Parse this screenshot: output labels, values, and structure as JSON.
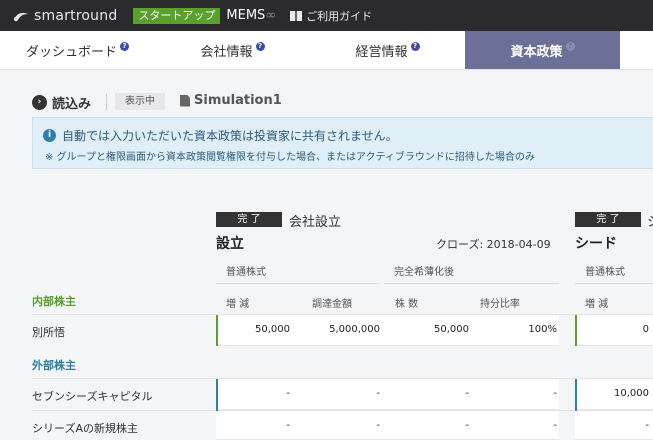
{
  "topbar": {
    "logo": "smartround",
    "plan": "スタートアップ",
    "company": "MEMS",
    "company_suffix": "∞",
    "guide": "ご利用ガイド"
  },
  "tabs": [
    {
      "label": "ダッシュボード",
      "help": "?"
    },
    {
      "label": "会社情報",
      "help": "?"
    },
    {
      "label": "経営情報",
      "help": "?"
    },
    {
      "label": "資本政策",
      "help": "?"
    }
  ],
  "toolbar": {
    "load_icon": "›",
    "load_label": "読込み",
    "status": "表示中",
    "simulation": "Simulation1"
  },
  "info": {
    "icon": "i",
    "line1": "自動では入力いただいた資本政策は投資家に共有されません。",
    "line2": "※ グループと権限画面から資本政策閲覧権限を付与した場合、またはアクティブラウンドに招待した場合のみ"
  },
  "rounds": [
    {
      "status": "完 了",
      "subtitle": "会社設立",
      "name": "設立",
      "close_date": "クローズ: 2018-04-09",
      "group_common": "普通株式",
      "group_diluted": "完全希薄化後",
      "col_change": "増 減",
      "col_amount": "調達金額",
      "col_shares": "株 数",
      "col_ratio": "持分比率"
    },
    {
      "status": "完 了",
      "subtitle": "シ",
      "name": "シード",
      "group_common": "普通株式",
      "col_change": "増 減"
    }
  ],
  "sections": {
    "internal": "内部株主",
    "external": "外部株主"
  },
  "rows": {
    "r1": {
      "label": "別所悟",
      "change": "50,000",
      "amount": "5,000,000",
      "shares": "50,000",
      "ratio": "100%",
      "seed_change": "0"
    },
    "r2": {
      "label": "セブンシーズキャピタル",
      "change": "-",
      "amount": "-",
      "shares": "-",
      "ratio": "-",
      "seed_change": "10,000"
    },
    "r3": {
      "label": "シリーズAの新規株主",
      "change": "-",
      "amount": "-",
      "shares": "-",
      "ratio": "-",
      "seed_change": "-"
    }
  },
  "colors": {
    "internal": "#5aa02c",
    "external": "#2f7fa0",
    "active_tab": "#6c6f97"
  }
}
